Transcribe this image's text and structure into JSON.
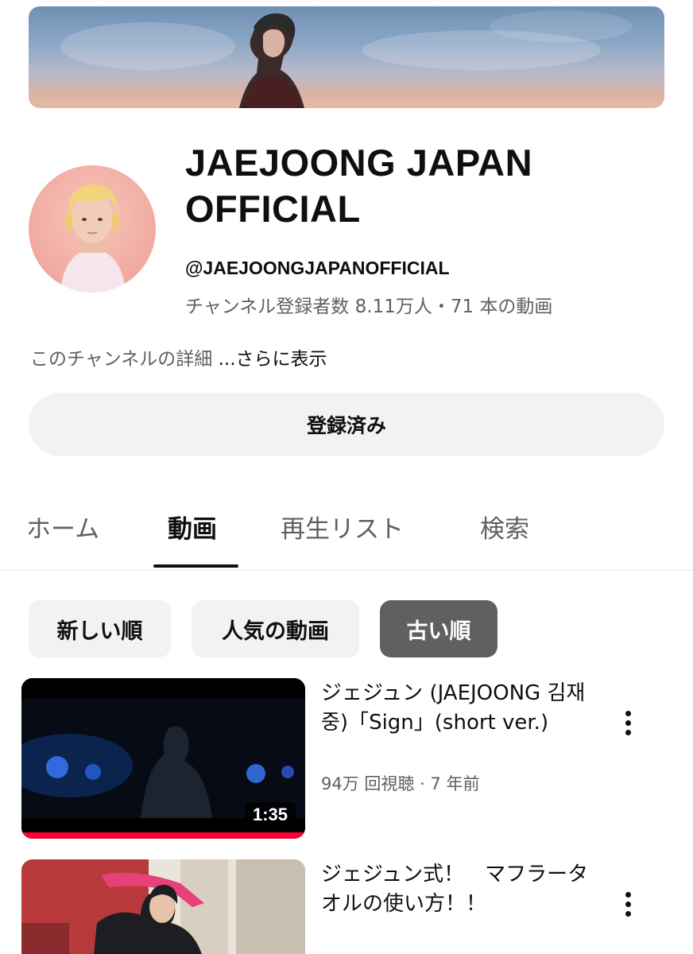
{
  "channel": {
    "name": "JAEJOONG JAPAN OFFICIAL",
    "handle": "@JAEJOONGJAPANOFFICIAL",
    "stats": "チャンネル登録者数 8.11万人・71 本の動画",
    "description_prefix": "このチャンネルの詳細 ",
    "description_more": "...さらに表示",
    "subscribe_label": "登録済み"
  },
  "tabs": [
    {
      "label": "ホーム"
    },
    {
      "label": "動画"
    },
    {
      "label": "再生リスト"
    },
    {
      "label": "検索"
    }
  ],
  "active_tab": "動画",
  "chips": [
    {
      "label": "新しい順"
    },
    {
      "label": "人気の動画"
    },
    {
      "label": "古い順"
    }
  ],
  "selected_chip": "古い順",
  "videos": [
    {
      "title": "ジェジュン (JAEJOONG 김재중)「Sign」(short ver.)",
      "meta": "94万 回視聴 · 7 年前",
      "duration": "1:35",
      "watched_fraction": 1.0
    },
    {
      "title": "ジェジュン式！　マフラータオルの使い方！！"
    }
  ],
  "colors": {
    "text_primary": "#0f0f0f",
    "text_secondary": "#606060",
    "chip_bg": "#f2f2f2",
    "chip_selected_bg": "#606060",
    "progress_red": "#ff0033"
  }
}
